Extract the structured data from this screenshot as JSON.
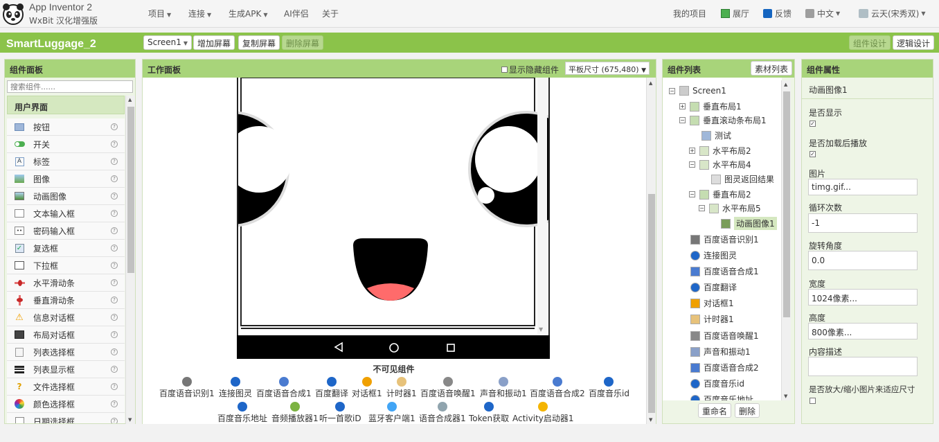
{
  "brand": {
    "title": "App Inventor 2",
    "subtitle": "WxBit 汉化增强版"
  },
  "topnav": [
    "项目",
    "连接",
    "生成APK",
    "AI伴侣",
    "关于"
  ],
  "topright": {
    "my_projects": "我的项目",
    "gallery": "展厅",
    "feedback": "反馈",
    "language": "中文",
    "user": "云天(宋秀双)"
  },
  "project": {
    "name": "SmartLuggage_2"
  },
  "toolbar": {
    "screen_select": "Screen1",
    "add_screen": "增加屏幕",
    "copy_screen": "复制屏幕",
    "remove_screen": "删除屏幕",
    "designer": "组件设计",
    "blocks": "逻辑设计"
  },
  "palette": {
    "title": "组件面板",
    "search_placeholder": "搜索组件......",
    "category": "用户界面",
    "items": [
      "按钮",
      "开关",
      "标签",
      "图像",
      "动画图像",
      "文本输入框",
      "密码输入框",
      "复选框",
      "下拉框",
      "水平滑动条",
      "垂直滑动条",
      "信息对话框",
      "布局对话框",
      "列表选择框",
      "列表显示框",
      "文件选择框",
      "颜色选择框",
      "日期选择框"
    ]
  },
  "viewer": {
    "title": "工作面板",
    "show_hidden": "显示隐藏组件",
    "size_select": "平板尺寸 (675,480)",
    "nonvisible_title": "不可见组件",
    "nonvisible_row1": [
      "百度语音识别1",
      "连接图灵",
      "百度语音合成1",
      "百度翻译",
      "对话框1",
      "计时器1",
      "百度语音唤醒1",
      "声音和振动1",
      "百度语音合成2",
      "百度音乐id"
    ],
    "nonvisible_row2": [
      "百度音乐地址",
      "音频播放器1",
      "听一首歌iD",
      "蓝牙客户端1",
      "语音合成器1",
      "Token获取",
      "Activity启动器1"
    ]
  },
  "tree": {
    "title": "组件列表",
    "media_button": "素材列表",
    "rename": "重命名",
    "delete": "删除",
    "nodes": [
      "Screen1",
      "垂直布局1",
      "垂直滚动条布局1",
      "测试",
      "水平布局2",
      "水平布局4",
      "图灵返回结果",
      "垂直布局2",
      "水平布局5",
      "动画图像1",
      "百度语音识别1",
      "连接图灵",
      "百度语音合成1",
      "百度翻译",
      "对话框1",
      "计时器1",
      "百度语音唤醒1",
      "声音和振动1",
      "百度语音合成2",
      "百度音乐id",
      "百度音乐地址"
    ]
  },
  "props": {
    "title": "组件属性",
    "component": "动画图像1",
    "visible_label": "是否显示",
    "autoplay_label": "是否加载后播放",
    "image_label": "图片",
    "image_value": "timg.gif...",
    "loop_label": "循环次数",
    "loop_value": "-1",
    "rotation_label": "旋转角度",
    "rotation_value": "0.0",
    "width_label": "宽度",
    "width_value": "1024像素...",
    "height_label": "高度",
    "height_value": "800像素...",
    "desc_label": "内容描述",
    "desc_value": "",
    "scale_label": "是否放大/缩小图片来适应尺寸"
  },
  "colors": {
    "accent": "#8bc34a",
    "panel_header": "#a8d47a",
    "selected": "#d5e8c0"
  }
}
